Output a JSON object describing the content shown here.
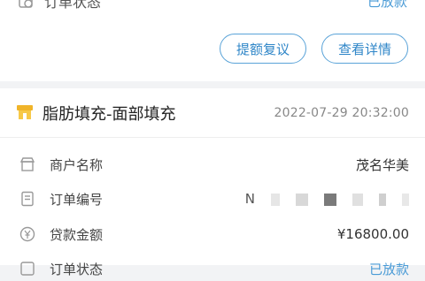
{
  "status_row": {
    "label": "订单状态",
    "value": "已放款"
  },
  "buttons": {
    "review": "提额复议",
    "detail": "查看详情"
  },
  "order": {
    "title": "脂肪填充-面部填充",
    "time": "2022-07-29 20:32:00",
    "fields": [
      {
        "label": "商户名称",
        "value": "茂名华美",
        "icon": "store-icon"
      },
      {
        "label": "订单编号",
        "value": "N",
        "icon": "document-icon"
      },
      {
        "label": "贷款金额",
        "value": "¥16800.00",
        "icon": "yuan-coin-icon"
      },
      {
        "label": "订单状态",
        "value": "已放款",
        "icon": "status-icon"
      }
    ]
  },
  "colors": {
    "accent": "#2f86c8",
    "shop_icon": "#f0b429"
  }
}
